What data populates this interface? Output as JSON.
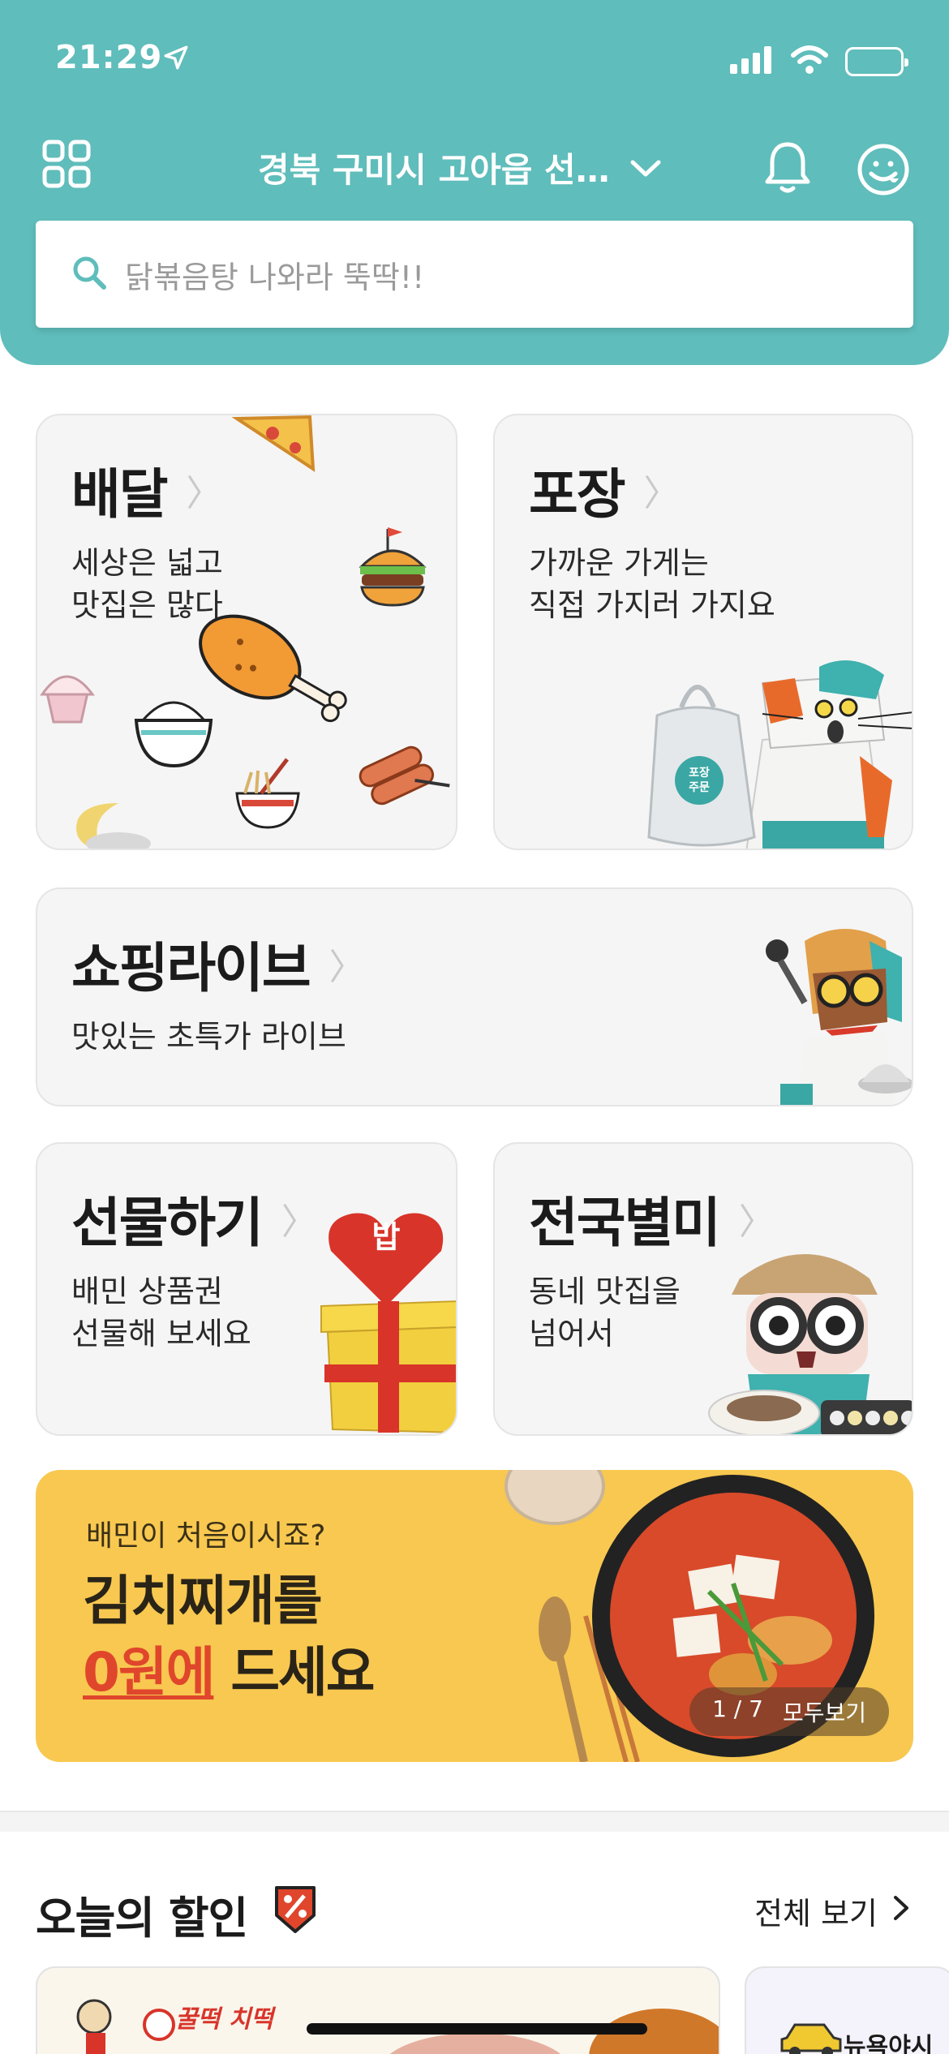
{
  "status": {
    "time": "21:29"
  },
  "header": {
    "location": "경북 구미시 고아읍 선…"
  },
  "search": {
    "placeholder": "닭볶음탕 나와라 뚝딱!!"
  },
  "tiles": {
    "delivery": {
      "title": "배달",
      "desc1": "세상은 넓고",
      "desc2": "맛집은 많다"
    },
    "takeout": {
      "title": "포장",
      "desc1": "가까운 가게는",
      "desc2": "직접 가지러 가지요",
      "bag_label1": "포장",
      "bag_label2": "주문"
    },
    "live": {
      "title": "쇼핑라이브",
      "desc1": "맛있는 초특가 라이브"
    },
    "gift": {
      "title": "선물하기",
      "desc1": "배민 상품권",
      "desc2": "선물해 보세요",
      "heart_label": "밥"
    },
    "national": {
      "title": "전국별미",
      "desc1": "동네 맛집을",
      "desc2": "넘어서"
    }
  },
  "banner": {
    "subtitle": "배민이 처음이시죠?",
    "line1": "김치찌개를",
    "line2_highlight": "0원에",
    "line2_rest": " 드세요",
    "page_current": "1 / 7",
    "see_all": "모두보기"
  },
  "deals": {
    "title": "오늘의 할인",
    "see_all": "전체 보기",
    "card1_brand": "꿀떡 치떡",
    "card2_brand": "뉴욕야시"
  },
  "colors": {
    "brand": "#5fbdbb",
    "banner": "#f8c850",
    "accent_red": "#e0462c"
  }
}
